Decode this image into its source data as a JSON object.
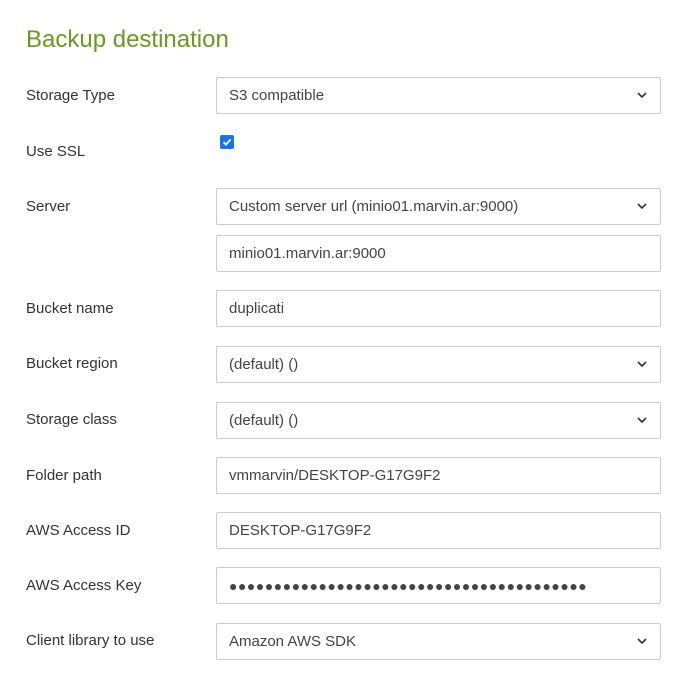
{
  "section": {
    "title": "Backup destination"
  },
  "fields": {
    "storage_type": {
      "label": "Storage Type",
      "value": "S3 compatible"
    },
    "use_ssl": {
      "label": "Use SSL",
      "checked": true
    },
    "server": {
      "label": "Server",
      "value": "Custom server url (minio01.marvin.ar:9000)",
      "custom_url": "minio01.marvin.ar:9000"
    },
    "bucket_name": {
      "label": "Bucket name",
      "value": "duplicati"
    },
    "bucket_region": {
      "label": "Bucket region",
      "value": "(default) ()"
    },
    "storage_class": {
      "label": "Storage class",
      "value": "(default) ()"
    },
    "folder_path": {
      "label": "Folder path",
      "value": "vmmarvin/DESKTOP-G17G9F2"
    },
    "aws_access_id": {
      "label": "AWS Access ID",
      "value": "DESKTOP-G17G9F2"
    },
    "aws_access_key": {
      "label": "AWS Access Key",
      "value": "●●●●●●●●●●●●●●●●●●●●●●●●●●●●●●●●●●●●●●●●"
    },
    "client_library": {
      "label": "Client library to use",
      "value": "Amazon AWS SDK"
    }
  },
  "colors": {
    "title": "#6a9a24",
    "checkbox": "#1a73e8",
    "border": "#cccccc"
  },
  "icons": {
    "dropdown": "chevron-down-icon",
    "check": "check-icon"
  }
}
